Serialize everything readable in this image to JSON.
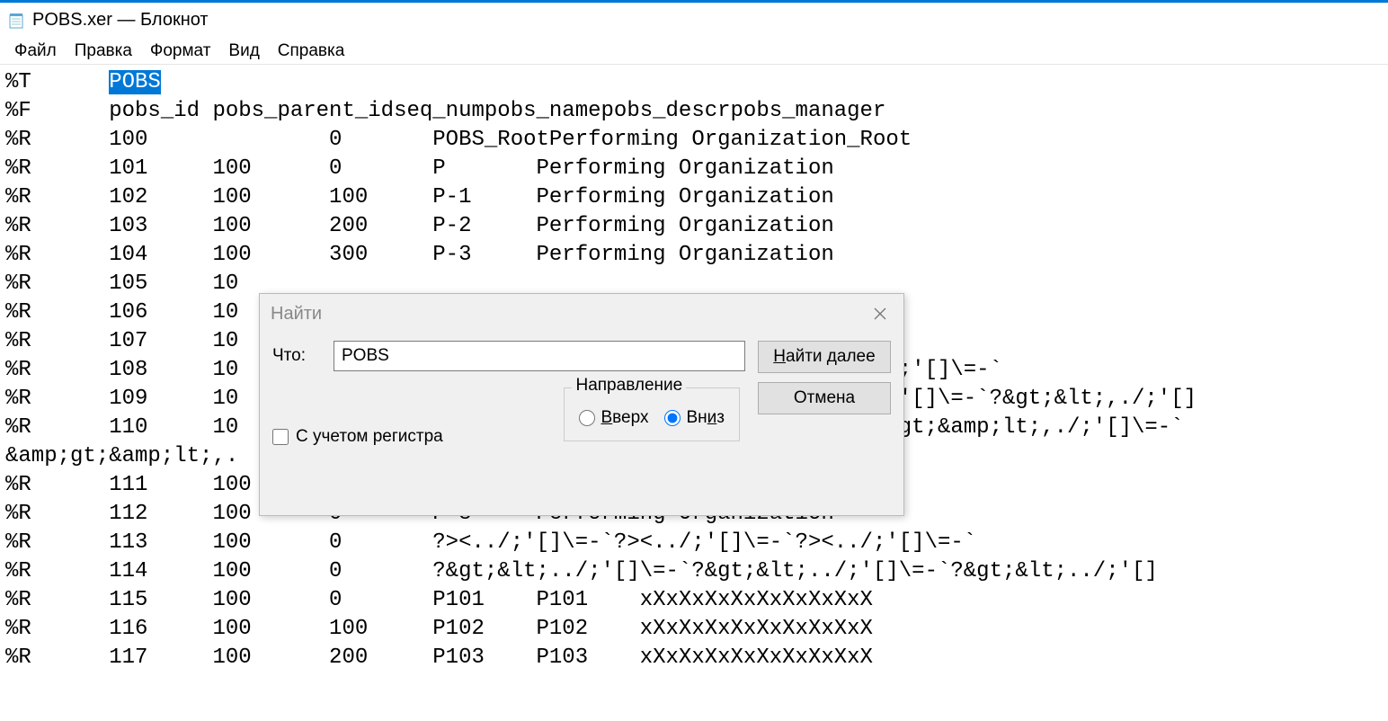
{
  "window": {
    "title": "POBS.xer — Блокнот"
  },
  "menu": {
    "file": "Файл",
    "edit": "Правка",
    "format": "Формат",
    "view": "Вид",
    "help": "Справка"
  },
  "editor": {
    "selected": "POBS",
    "lines": [
      "%T\tPOBS",
      "%F\tpobs_id\tpobs_parent_id\tseq_num\tpobs_name\tpobs_descr\tpobs_manager",
      "%R\t100\t\t0\tPOBS_Root\tPerforming Organization_Root",
      "%R\t101\t100\t0\tP\tPerforming Organization",
      "%R\t102\t100\t100\tP-1\tPerforming Organization",
      "%R\t103\t100\t200\tP-2\tPerforming Organization",
      "%R\t104\t100\t300\tP-3\tPerforming Organization",
      "%R\t105\t10",
      "%R\t106\t10",
      "%R\t107\t10",
      "%R\t108\t10                                             ?><,./;'[]\\=-`",
      "%R\t109\t10                                             t;,./;'[]\\=-`\t?&gt;&lt;,./;'[]",
      "%R\t110\t10                                             ?&amp;gt;&amp;lt;,./;'[]\\=-`\t",
      "&amp;gt;&amp;lt;,.",
      "%R\t111\t100\t0\tP-7\tPerforming Organization",
      "%R\t112\t100\t0\tP-8\tPerforming Organization",
      "%R\t113\t100\t0\t?><../;'[]\\=-`\t?><../;'[]\\=-`\t?><../;'[]\\=-`",
      "%R\t114\t100\t0\t?&gt;&lt;../;'[]\\=-`\t?&gt;&lt;../;'[]\\=-`\t?&gt;&lt;../;'[]",
      "%R\t115\t100\t0\tP101\tP101\txXxXxXxXxXxXxXxXxX",
      "%R\t116\t100\t100\tP102\tP102\txXxXxXxXxXxXxXxXxX",
      "%R\t117\t100\t200\tP103\tP103\txXxXxXxXxXxXxXxXxX"
    ]
  },
  "find": {
    "title": "Найти",
    "what_label": "Что:",
    "what_value": "POBS",
    "case_label": "С учетом регистра",
    "case_checked": false,
    "dir_label": "Направление",
    "dir_up": "Вверх",
    "dir_down": "Вниз",
    "dir_value": "down",
    "btn_next": "Найти далее",
    "btn_next_u": "Н",
    "btn_next_rest": "айти далее",
    "btn_cancel": "Отмена",
    "down_u": "и",
    "down_pre": "Вн",
    "down_post": "з",
    "up_u": "В",
    "up_rest": "верх"
  }
}
